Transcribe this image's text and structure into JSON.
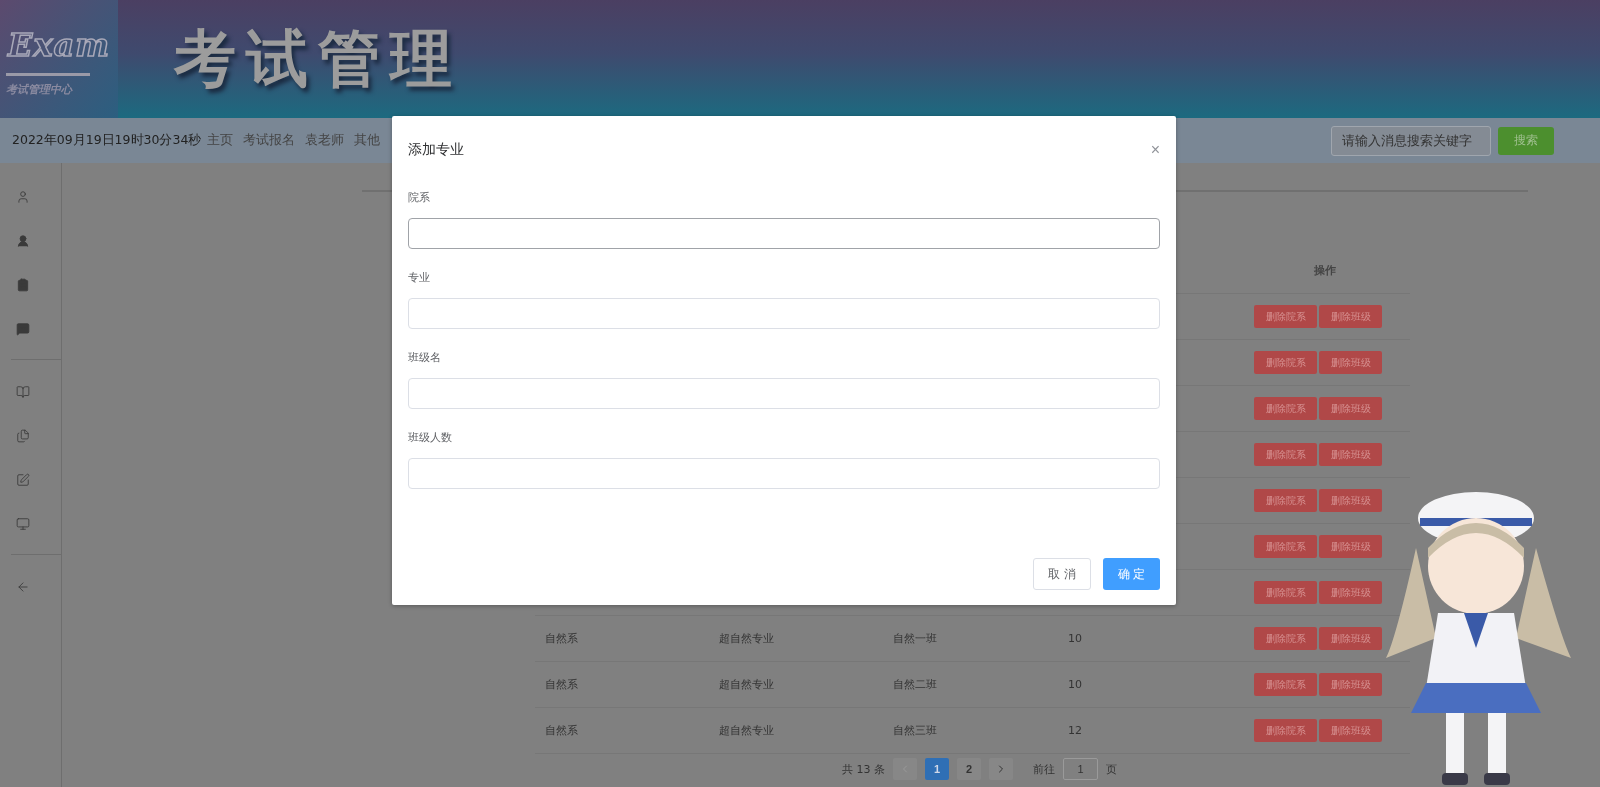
{
  "header": {
    "logo_text": "Exam",
    "logo_subtitle": "考试管理中心",
    "title": "考试管理"
  },
  "nav": {
    "datetime": "2022年09月19日19时30分34秒",
    "links": [
      "主页",
      "考试报名",
      "袁老师",
      "其他"
    ],
    "search": {
      "placeholder": "请输入消息搜索关键字"
    },
    "search_button": "搜索"
  },
  "table": {
    "action_header": "操作",
    "rows": [
      {
        "actions": [
          "删除院系",
          "删除班级"
        ]
      },
      {
        "actions": [
          "删除院系",
          "删除班级"
        ]
      },
      {
        "actions": [
          "删除院系",
          "删除班级"
        ]
      },
      {
        "actions": [
          "删除院系",
          "删除班级"
        ]
      },
      {
        "actions": [
          "删除院系",
          "删除班级"
        ]
      },
      {
        "actions": [
          "删除院系",
          "删除班级"
        ]
      },
      {
        "actions": [
          "删除院系",
          "删除班级"
        ]
      },
      {
        "cells": [
          "自然系",
          "超自然专业",
          "自然一班",
          "10"
        ],
        "actions": [
          "删除院系",
          "删除班级"
        ]
      },
      {
        "cells": [
          "自然系",
          "超自然专业",
          "自然二班",
          "10"
        ],
        "actions": [
          "删除院系",
          "删除班级"
        ]
      },
      {
        "cells": [
          "自然系",
          "超自然专业",
          "自然三班",
          "12"
        ],
        "actions": [
          "删除院系",
          "删除班级"
        ]
      }
    ]
  },
  "pagination": {
    "total": "共 13 条",
    "prev_disabled": true,
    "pages": [
      {
        "label": "1",
        "selected": true
      },
      {
        "label": "2",
        "selected": false
      }
    ],
    "goto_label": "前往",
    "goto_value": "1",
    "page_suffix": "页"
  },
  "dialog": {
    "title": "添加专业",
    "close": "×",
    "fields": [
      {
        "label": "院系",
        "focused": true
      },
      {
        "label": "专业",
        "focused": false
      },
      {
        "label": "班级名",
        "focused": false
      },
      {
        "label": "班级人数",
        "focused": false
      }
    ],
    "cancel": "取 消",
    "confirm": "确 定"
  }
}
